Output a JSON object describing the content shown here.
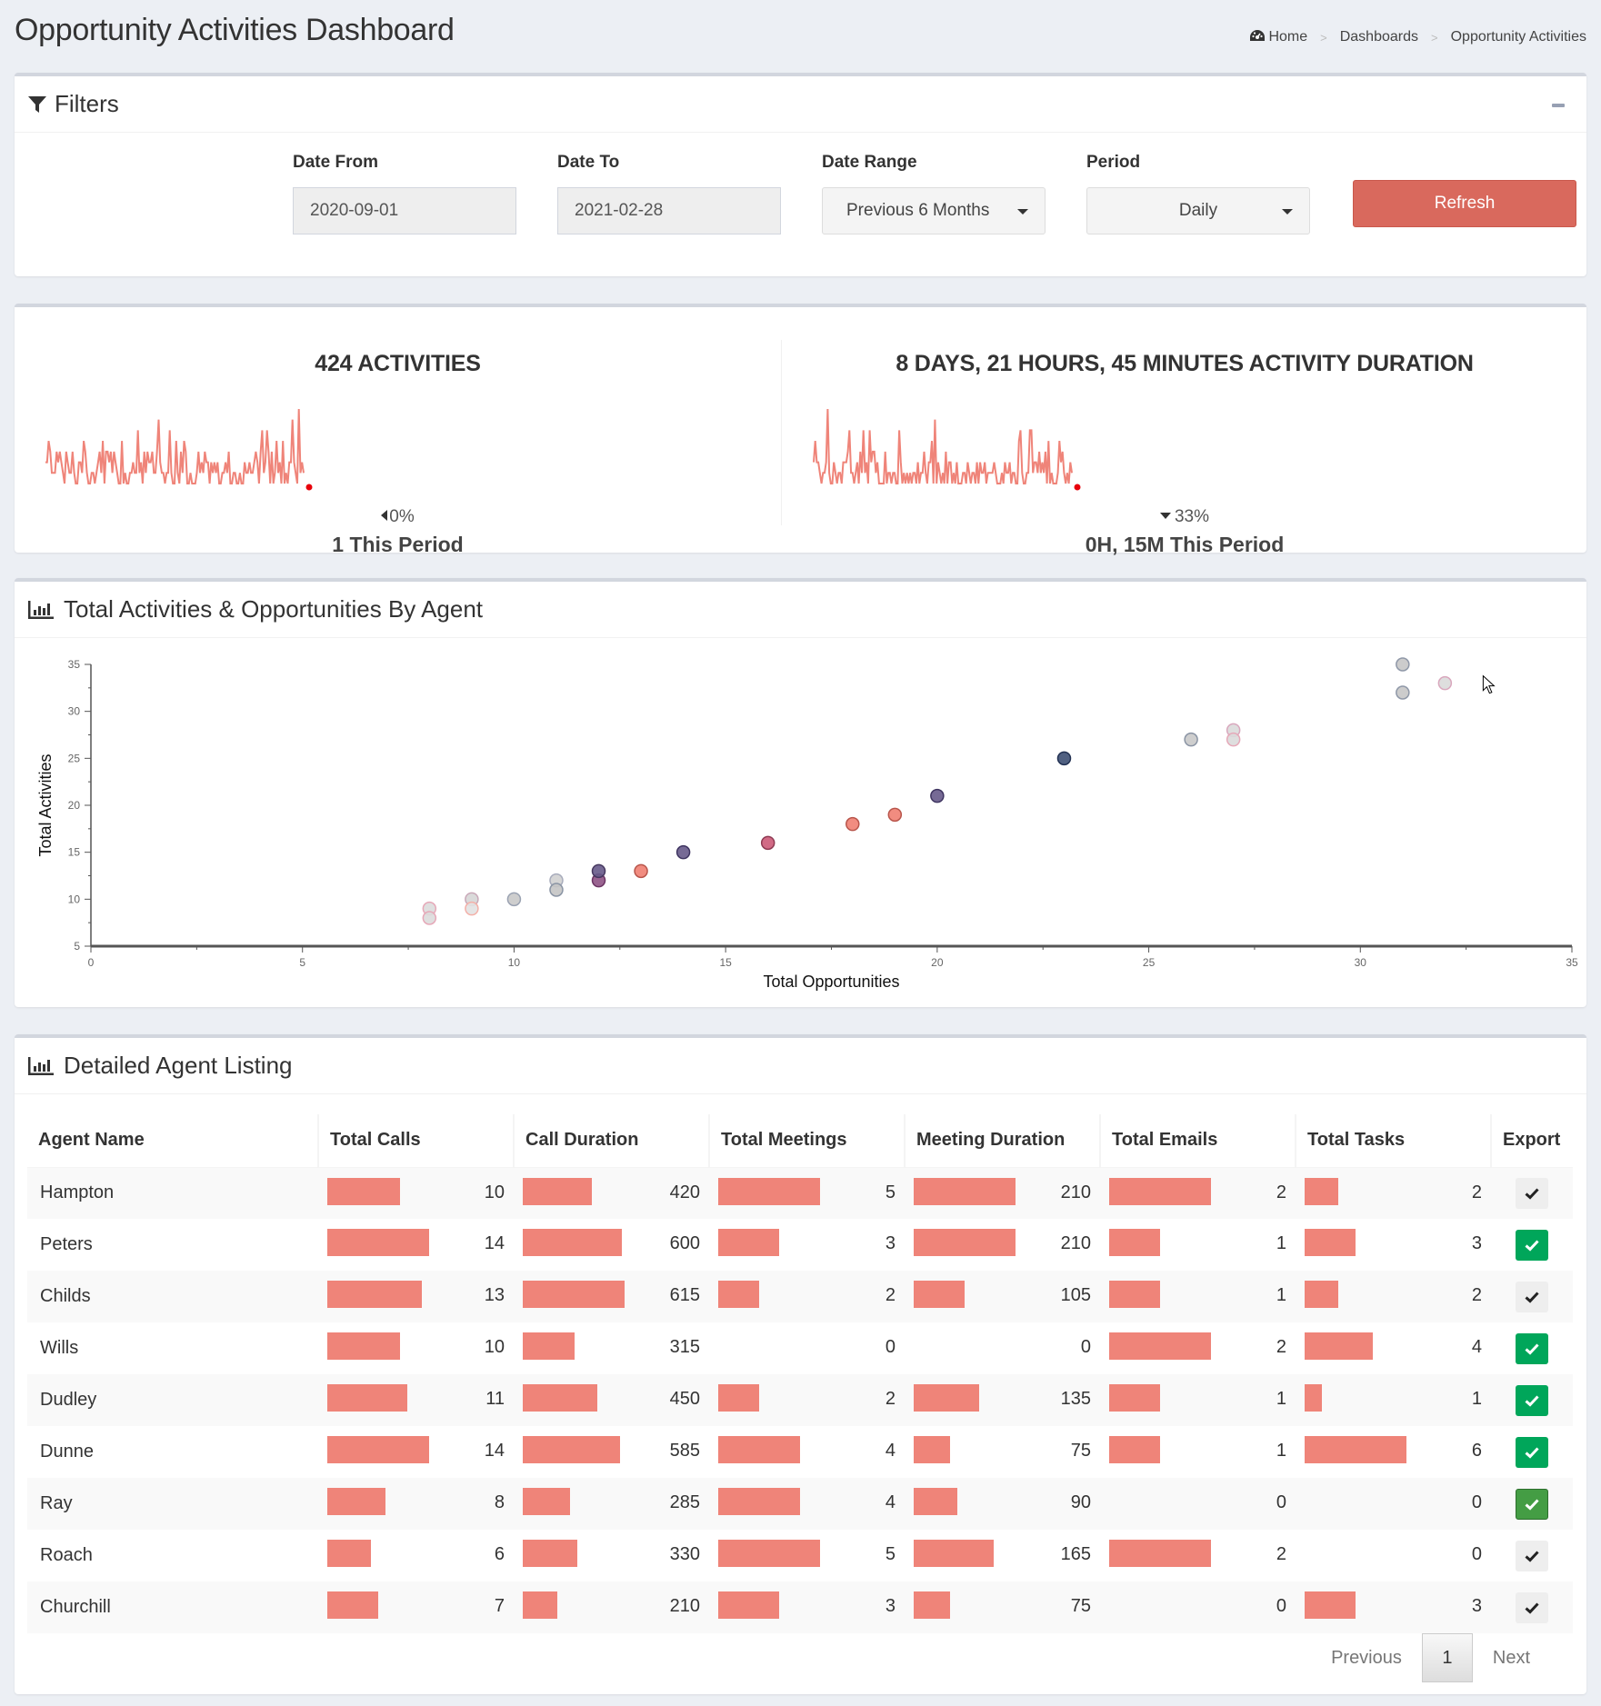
{
  "header": {
    "title": "Opportunity Activities Dashboard",
    "breadcrumb": [
      {
        "label": "Home",
        "icon": "dashboard-icon"
      },
      {
        "label": "Dashboards"
      },
      {
        "label": "Opportunity Activities"
      }
    ],
    "breadcrumb_separator": ">"
  },
  "filters": {
    "title": "Filters",
    "icon": "filter-icon",
    "date_from": {
      "label": "Date From",
      "value": "2020-09-01"
    },
    "date_to": {
      "label": "Date To",
      "value": "2021-02-28"
    },
    "date_range": {
      "label": "Date Range",
      "value": "Previous 6 Months"
    },
    "period": {
      "label": "Period",
      "value": "Daily"
    },
    "refresh_label": "Refresh",
    "accent_color": "#d9695d"
  },
  "kpis": {
    "activities": {
      "title": "424 ACTIVITIES",
      "change": "0%",
      "change_direction": "flat",
      "period_value": "1 This Period",
      "sparkline": [
        3,
        3,
        5,
        4,
        2,
        2,
        2,
        4,
        3,
        4,
        3,
        2,
        1,
        4,
        3,
        2,
        2,
        4,
        2,
        1,
        1,
        3,
        3,
        2,
        5,
        4,
        2,
        1,
        1,
        2,
        2,
        1,
        2,
        3,
        4,
        2,
        5,
        1,
        4,
        4,
        3,
        4,
        2,
        4,
        3,
        2,
        1,
        1,
        5,
        1,
        2,
        1,
        1,
        2,
        2,
        3,
        2,
        2,
        6,
        2,
        3,
        1,
        4,
        2,
        4,
        3,
        3,
        4,
        2,
        2,
        4,
        7,
        3,
        2,
        2,
        1,
        2,
        2,
        6,
        2,
        1,
        1,
        5,
        2,
        1,
        4,
        2,
        5,
        4,
        1,
        1,
        2,
        1,
        1,
        1,
        2,
        4,
        2,
        3,
        2,
        4,
        3,
        3,
        1,
        3,
        2,
        3,
        2,
        3,
        1,
        1,
        2,
        2,
        3,
        2,
        4,
        1,
        1,
        2,
        2,
        1,
        1,
        2,
        1,
        1,
        3,
        2,
        2,
        3,
        2,
        2,
        3,
        4,
        3,
        1,
        4,
        6,
        2,
        3,
        6,
        4,
        1,
        4,
        1,
        2,
        5,
        2,
        3,
        1,
        5,
        1,
        2,
        1,
        3,
        3,
        7,
        3,
        2,
        1,
        8,
        2,
        3,
        2
      ],
      "last_point_color": "#e8000b"
    },
    "duration": {
      "title": "8 DAYS, 21 HOURS, 45 MINUTES ACTIVITY DURATION",
      "change": "33%",
      "change_direction": "down",
      "period_value": "0H, 15M This Period",
      "sparkline": [
        3,
        5,
        3,
        3,
        2,
        1,
        2,
        2,
        3,
        8,
        2,
        1,
        1,
        3,
        2,
        1,
        2,
        2,
        1,
        3,
        3,
        3,
        4,
        6,
        2,
        2,
        1,
        2,
        3,
        1,
        4,
        2,
        6,
        2,
        3,
        1,
        6,
        3,
        4,
        4,
        2,
        3,
        1,
        1,
        1,
        1,
        4,
        1,
        2,
        2,
        1,
        2,
        2,
        1,
        1,
        6,
        3,
        1,
        2,
        1,
        2,
        1,
        2,
        1,
        2,
        2,
        1,
        3,
        1,
        2,
        2,
        4,
        2,
        1,
        3,
        3,
        5,
        1,
        7,
        1,
        3,
        2,
        1,
        2,
        1,
        4,
        1,
        3,
        3,
        1,
        2,
        1,
        3,
        1,
        1,
        1,
        2,
        2,
        1,
        3,
        2,
        1,
        2,
        2,
        1,
        3,
        1,
        3,
        2,
        2,
        3,
        1,
        2,
        2,
        2,
        2,
        3,
        2,
        1,
        1,
        1,
        2,
        1,
        3,
        2,
        2,
        3,
        1,
        2,
        2,
        1,
        1,
        5,
        6,
        2,
        1,
        1,
        2,
        2,
        6,
        6,
        2,
        3,
        3,
        2,
        4,
        2,
        3,
        2,
        4,
        1,
        5,
        1,
        2,
        1,
        1,
        1,
        2,
        5,
        3,
        4,
        2,
        1,
        2,
        1,
        3,
        2
      ],
      "last_point_color": "#e8000b"
    }
  },
  "scatter": {
    "title": "Total Activities & Opportunities By Agent",
    "icon": "bar-chart-icon"
  },
  "chart_data": {
    "type": "scatter",
    "title": "Total Activities & Opportunities By Agent",
    "xlabel": "Total Opportunities",
    "ylabel": "Total Activities",
    "xlim": [
      0,
      35
    ],
    "ylim": [
      5,
      35
    ],
    "xticks": [
      0,
      5,
      10,
      15,
      20,
      25,
      30,
      35
    ],
    "yticks": [
      5,
      10,
      15,
      20,
      25,
      30,
      35
    ],
    "grid": false,
    "legend": "none",
    "points": [
      {
        "x": 8,
        "y": 9,
        "fill": "#dcdcdc",
        "stroke": "#e6a8b8"
      },
      {
        "x": 8,
        "y": 8,
        "fill": "#dcdcdc",
        "stroke": "#e6a8b8"
      },
      {
        "x": 9,
        "y": 10,
        "fill": "#d6d6d6",
        "stroke": "#c9a8b8"
      },
      {
        "x": 9,
        "y": 9,
        "fill": "#e2e2e2",
        "stroke": "#f4b0a8"
      },
      {
        "x": 10,
        "y": 10,
        "fill": "#c9c9c9",
        "stroke": "#9aa2b2"
      },
      {
        "x": 11,
        "y": 12,
        "fill": "#d0d0d0",
        "stroke": "#a8acbc"
      },
      {
        "x": 11,
        "y": 11,
        "fill": "#c4c4c4",
        "stroke": "#8a94a4"
      },
      {
        "x": 12,
        "y": 12,
        "fill": "#8f5385",
        "stroke": "#6b3463"
      },
      {
        "x": 12,
        "y": 13,
        "fill": "#675a8a",
        "stroke": "#46385f"
      },
      {
        "x": 13,
        "y": 13,
        "fill": "#ef7f72",
        "stroke": "#b8554b"
      },
      {
        "x": 14,
        "y": 15,
        "fill": "#675a8a",
        "stroke": "#3e3460"
      },
      {
        "x": 16,
        "y": 16,
        "fill": "#cc5a78",
        "stroke": "#8e3a52"
      },
      {
        "x": 18,
        "y": 18,
        "fill": "#ef7f72",
        "stroke": "#b8554b"
      },
      {
        "x": 19,
        "y": 19,
        "fill": "#ef7f72",
        "stroke": "#b8554b"
      },
      {
        "x": 20,
        "y": 21,
        "fill": "#675a8a",
        "stroke": "#3e3460"
      },
      {
        "x": 23,
        "y": 25,
        "fill": "#3d4f73",
        "stroke": "#223152"
      },
      {
        "x": 26,
        "y": 27,
        "fill": "#c9c9c9",
        "stroke": "#8a94a4"
      },
      {
        "x": 27,
        "y": 28,
        "fill": "#dadada",
        "stroke": "#d9a7bd"
      },
      {
        "x": 27,
        "y": 27,
        "fill": "#dadada",
        "stroke": "#e6a8b8"
      },
      {
        "x": 31,
        "y": 35,
        "fill": "#c6c6c6",
        "stroke": "#8f98a8"
      },
      {
        "x": 31,
        "y": 32,
        "fill": "#c6c6c6",
        "stroke": "#8f98a8"
      },
      {
        "x": 32,
        "y": 33,
        "fill": "#dadada",
        "stroke": "#d9a7bd"
      }
    ]
  },
  "listing": {
    "title": "Detailed Agent Listing",
    "icon": "bar-chart-icon",
    "columns": [
      "Agent Name",
      "Total Calls",
      "Call Duration",
      "Total Meetings",
      "Meeting Duration",
      "Total Emails",
      "Total Tasks",
      "Export"
    ],
    "max": {
      "calls": 14,
      "call_duration": 615,
      "meetings": 5,
      "meeting_duration": 210,
      "emails": 2,
      "tasks": 6
    },
    "rows": [
      {
        "name": "Hampton",
        "calls": 10,
        "call_duration": 420,
        "meetings": 5,
        "meeting_duration": 210,
        "emails": 2,
        "tasks": 2,
        "export": false
      },
      {
        "name": "Peters",
        "calls": 14,
        "call_duration": 600,
        "meetings": 3,
        "meeting_duration": 210,
        "emails": 1,
        "tasks": 3,
        "export": true
      },
      {
        "name": "Childs",
        "calls": 13,
        "call_duration": 615,
        "meetings": 2,
        "meeting_duration": 105,
        "emails": 1,
        "tasks": 2,
        "export": false
      },
      {
        "name": "Wills",
        "calls": 10,
        "call_duration": 315,
        "meetings": 0,
        "meeting_duration": 0,
        "emails": 2,
        "tasks": 4,
        "export": true
      },
      {
        "name": "Dudley",
        "calls": 11,
        "call_duration": 450,
        "meetings": 2,
        "meeting_duration": 135,
        "emails": 1,
        "tasks": 1,
        "export": true
      },
      {
        "name": "Dunne",
        "calls": 14,
        "call_duration": 585,
        "meetings": 4,
        "meeting_duration": 75,
        "emails": 1,
        "tasks": 6,
        "export": true
      },
      {
        "name": "Ray",
        "calls": 8,
        "call_duration": 285,
        "meetings": 4,
        "meeting_duration": 90,
        "emails": 0,
        "tasks": 0,
        "export": true,
        "hover": true
      },
      {
        "name": "Roach",
        "calls": 6,
        "call_duration": 330,
        "meetings": 5,
        "meeting_duration": 165,
        "emails": 2,
        "tasks": 0,
        "export": false
      },
      {
        "name": "Churchill",
        "calls": 7,
        "call_duration": 210,
        "meetings": 3,
        "meeting_duration": 75,
        "emails": 0,
        "tasks": 3,
        "export": false
      }
    ],
    "bar_color": "#ef8479",
    "export_on_color": "#00a65a",
    "pagination": {
      "previous": "Previous",
      "current": "1",
      "next": "Next"
    }
  }
}
